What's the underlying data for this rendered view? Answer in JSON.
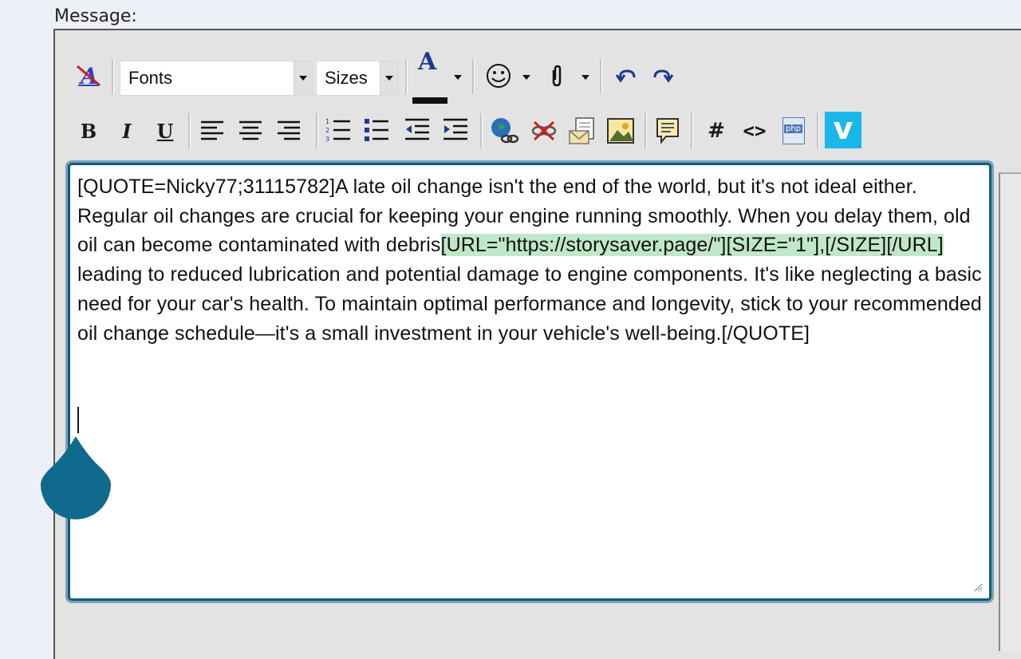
{
  "label": "Message:",
  "toolbar": {
    "fonts_label": "Fonts",
    "sizes_label": "Sizes",
    "text_color_glyph": "A",
    "bold_glyph": "B",
    "italic_glyph": "I",
    "underline_glyph": "U",
    "hash_glyph": "#",
    "code_glyph": "<>",
    "php_glyph": "php",
    "vimeo_glyph": "v",
    "icons": [
      "remove-format-icon",
      "text-color-icon",
      "smiley-icon",
      "attachment-icon",
      "undo-icon",
      "redo-icon",
      "bold-icon",
      "italic-icon",
      "underline-icon",
      "align-left-icon",
      "align-center-icon",
      "align-right-icon",
      "ordered-list-icon",
      "unordered-list-icon",
      "outdent-icon",
      "indent-icon",
      "insert-link-icon",
      "remove-link-icon",
      "insert-email-icon",
      "insert-image-icon",
      "quote-icon",
      "hash-icon",
      "code-icon",
      "php-icon",
      "vimeo-icon"
    ],
    "colors": {
      "text_color_bar": "#111111",
      "vimeo_bg": "#1ab7ea",
      "accent": "#0f5b7a",
      "highlight": "#c0e8c8"
    }
  },
  "editor": {
    "text_before": "[QUOTE=Nicky77;31115782]A late oil change isn't the end of the world, but it's not ideal either. Regular oil changes are crucial for keeping your engine running smoothly. When you delay them, old oil can become contaminated with debris",
    "highlight_1": "[URL=\"https://storysaver.page/\"]",
    "highlight_2": "[SIZE=\"1\"],[/SIZE][/URL]",
    "text_after": " leading to reduced lubrication and potential damage to engine components. It's like neglecting a basic need for your car's health. To maintain optimal performance and longevity, stick to your recommended oil change schedule—it's a small investment in your vehicle's well-being.[/QUOTE]"
  }
}
